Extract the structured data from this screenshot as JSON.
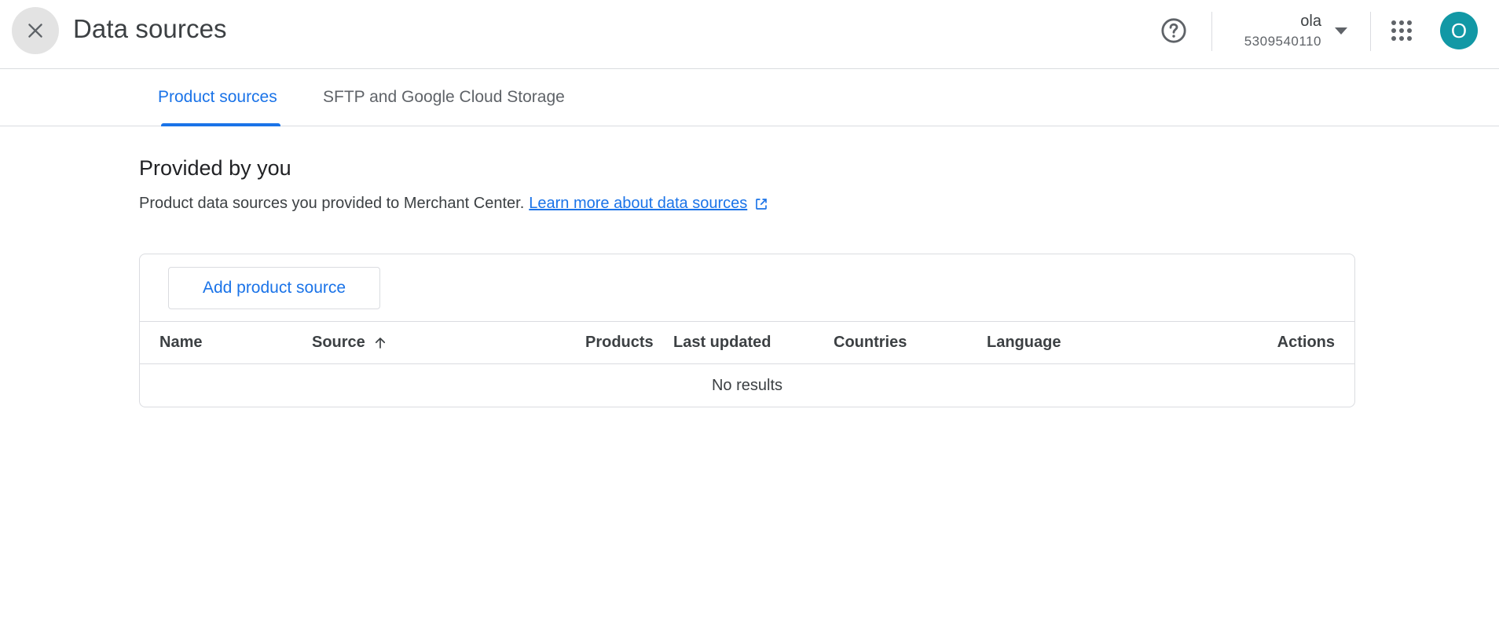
{
  "header": {
    "title": "Data sources",
    "account_name": "ola",
    "account_id": "5309540110",
    "avatar_initial": "O",
    "icons": [
      "close-icon",
      "help-icon",
      "caret-down-icon",
      "apps-grid-icon"
    ]
  },
  "tabs": [
    {
      "label": "Product sources",
      "active": true
    },
    {
      "label": "SFTP and Google Cloud Storage",
      "active": false
    }
  ],
  "section": {
    "title": "Provided by you",
    "description": "Product data sources you provided to Merchant Center.",
    "link_text": "Learn more about data sources"
  },
  "table": {
    "add_button": "Add product source",
    "columns": [
      "Name",
      "Source",
      "Products",
      "Last updated",
      "Countries",
      "Language",
      "Actions"
    ],
    "sorted_column": "Source",
    "sort_direction": "ascending",
    "empty_text": "No results"
  },
  "colors": {
    "accent": "#1a73e8",
    "avatar": "#1298a5",
    "divider": "#dadce0"
  }
}
